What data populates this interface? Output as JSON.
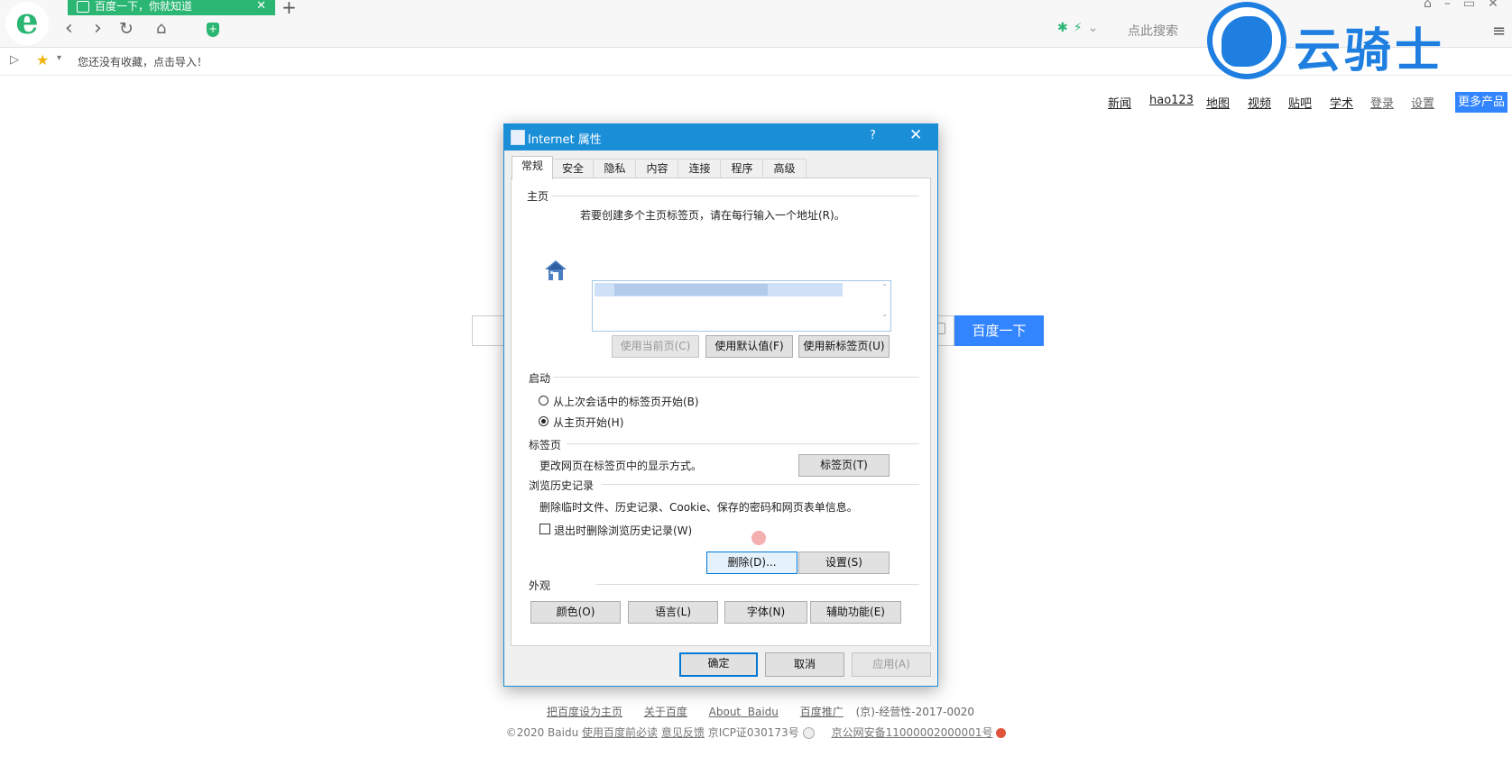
{
  "browser": {
    "tab_title": "百度一下，你就知道",
    "tab_close": "✕",
    "new_tab": "+",
    "search_placeholder": "点此搜索",
    "bookmarks_empty_text": "您还没有收藏，点击导入！"
  },
  "watermark": {
    "text": "云骑士"
  },
  "baidu": {
    "nav": [
      "新闻",
      "hao123",
      "地图",
      "视频",
      "贴吧",
      "学术",
      "登录",
      "设置"
    ],
    "more_products": "更多产品",
    "search_button": "百度一下",
    "footer_links": [
      "把百度设为主页",
      "关于百度",
      "About  Baidu",
      "百度推广"
    ],
    "footer_license": "(京)-经营性-2017-0020",
    "copyright": "©2020 Baidu",
    "footer_links2": [
      "使用百度前必读",
      "意见反馈"
    ],
    "icp": "京ICP证030173号",
    "police": "京公网安备11000002000001号"
  },
  "dialog": {
    "title": "Internet 属性",
    "help": "?",
    "close": "✕",
    "tabs": [
      "常规",
      "安全",
      "隐私",
      "内容",
      "连接",
      "程序",
      "高级"
    ],
    "active_tab": "常规",
    "homepage": {
      "heading": "主页",
      "description": "若要创建多个主页标签页，请在每行输入一个地址(R)。",
      "btn_current": "使用当前页(C)",
      "btn_default": "使用默认值(F)",
      "btn_new_tab": "使用新标签页(U)"
    },
    "startup": {
      "heading": "启动",
      "option_last_session": "从上次会话中的标签页开始(B)",
      "option_homepage": "从主页开始(H)",
      "selected": "从主页开始(H)"
    },
    "tabs_section": {
      "heading": "标签页",
      "description": "更改网页在标签页中的显示方式。",
      "btn": "标签页(T)"
    },
    "history": {
      "heading": "浏览历史记录",
      "description": "删除临时文件、历史记录、Cookie、保存的密码和网页表单信息。",
      "checkbox_label": "退出时删除浏览历史记录(W)",
      "checkbox_checked": false,
      "btn_delete": "删除(D)...",
      "btn_settings": "设置(S)"
    },
    "appearance": {
      "heading": "外观",
      "btn_colors": "颜色(O)",
      "btn_languages": "语言(L)",
      "btn_fonts": "字体(N)",
      "btn_accessibility": "辅助功能(E)"
    },
    "footer": {
      "ok": "确定",
      "cancel": "取消",
      "apply": "应用(A)"
    }
  },
  "colors": {
    "accent": "#1a8fd8",
    "baidu_blue": "#3385ff",
    "browser_green": "#2bb673"
  }
}
